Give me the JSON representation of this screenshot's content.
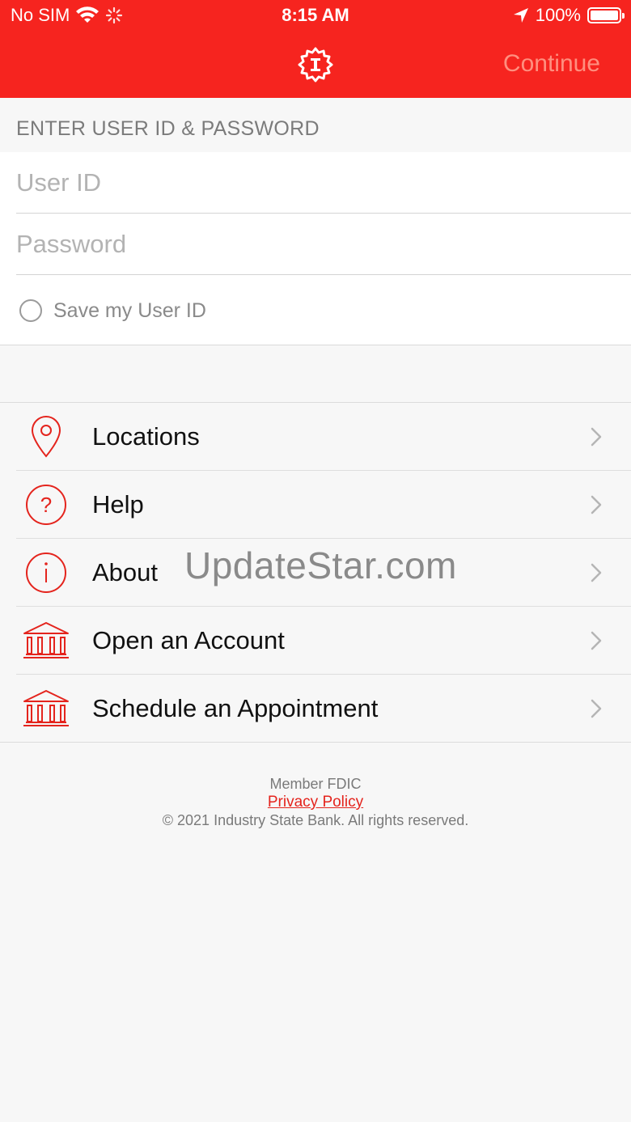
{
  "status_bar": {
    "carrier": "No SIM",
    "time": "8:15 AM",
    "battery": "100%"
  },
  "nav": {
    "continue_label": "Continue"
  },
  "login": {
    "section_title": "ENTER USER ID & PASSWORD",
    "user_id_placeholder": "User ID",
    "password_placeholder": "Password",
    "save_label": "Save my User ID"
  },
  "menu": {
    "items": [
      {
        "label": "Locations",
        "icon": "location-pin-icon"
      },
      {
        "label": "Help",
        "icon": "question-circle-icon"
      },
      {
        "label": "About",
        "icon": "info-circle-icon"
      },
      {
        "label": "Open an Account",
        "icon": "bank-icon"
      },
      {
        "label": "Schedule an Appointment",
        "icon": "bank-icon"
      }
    ]
  },
  "watermark": "UpdateStar.com",
  "footer": {
    "member": "Member FDIC",
    "privacy": "Privacy Policy",
    "copyright": "© 2021 Industry State Bank. All rights reserved."
  },
  "colors": {
    "brand_red": "#f6241f",
    "continue_disabled": "#ff8f7f",
    "icon_red": "#e4241d"
  }
}
